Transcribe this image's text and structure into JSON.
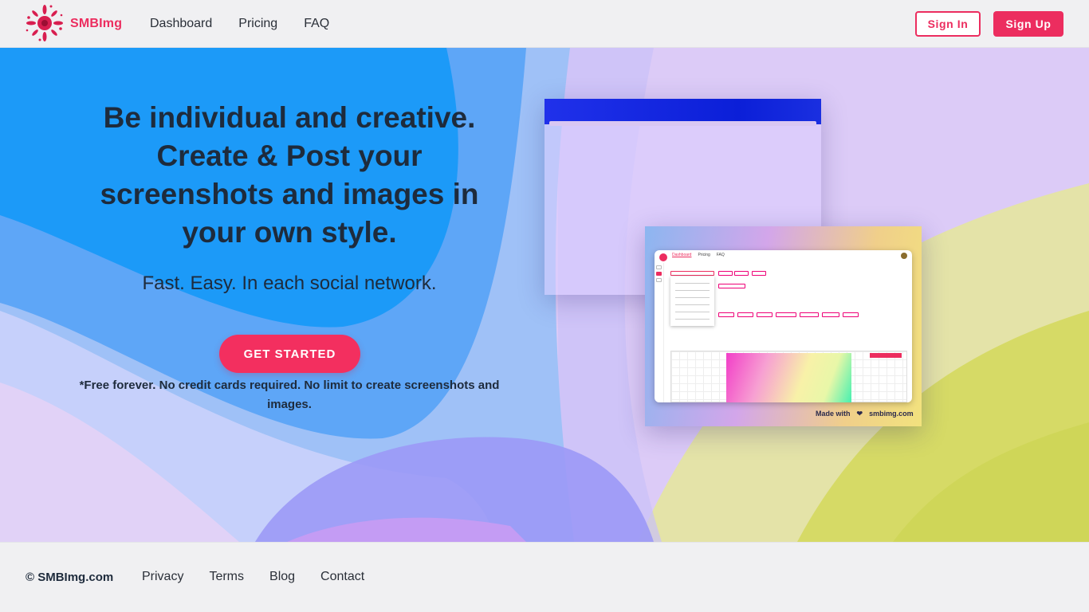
{
  "header": {
    "brand": "SMBImg",
    "nav": [
      "Dashboard",
      "Pricing",
      "FAQ"
    ],
    "sign_in": "Sign In",
    "sign_up": "Sign Up"
  },
  "hero": {
    "headline": "Be individual and creative. Create & Post your screenshots and images in your own style.",
    "subline": "Fast. Easy. In each social network.",
    "cta": "GET STARTED",
    "note": "*Free forever. No credit cards required. No limit to create screenshots and images.",
    "preview_made_with": "Made with",
    "preview_heart": "❤",
    "preview_site": "smbimg.com"
  },
  "footer": {
    "copyright": "© SMBImg.com",
    "links": [
      "Privacy",
      "Terms",
      "Blog",
      "Contact"
    ]
  },
  "colors": {
    "accent": "#ec2d5f",
    "text": "#1e2b3c"
  }
}
